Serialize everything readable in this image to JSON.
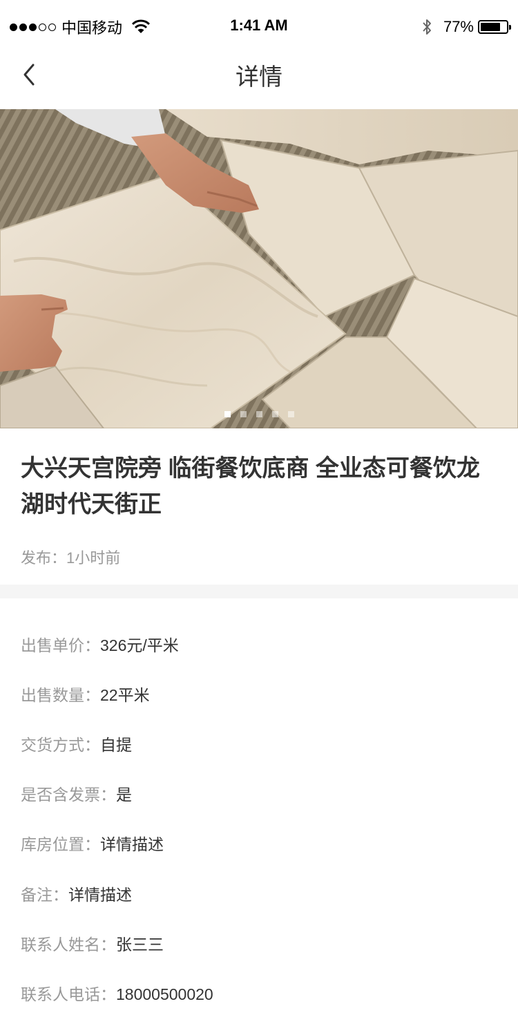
{
  "status_bar": {
    "carrier": "中国移动",
    "time": "1:41 AM",
    "battery_pct": "77%",
    "battery_level": 0.77
  },
  "nav": {
    "title": "详情",
    "back_icon": "chevron-left-icon"
  },
  "gallery": {
    "image_desc_icon": "tile-installation-photo",
    "page_count": 5,
    "active_index": 0
  },
  "listing": {
    "title": "大兴天宫院旁 临街餐饮底商 全业态可餐饮龙湖时代天街正",
    "publish_label": "发布：",
    "publish_value": "1小时前"
  },
  "details": [
    {
      "label": "出售单价：",
      "value": "326元/平米"
    },
    {
      "label": "出售数量：",
      "value": "22平米"
    },
    {
      "label": "交货方式：",
      "value": "自提"
    },
    {
      "label": "是否含发票：",
      "value": "是"
    },
    {
      "label": "库房位置：",
      "value": "详情描述"
    },
    {
      "label": "备注：",
      "value": "详情描述"
    },
    {
      "label": "联系人姓名：",
      "value": "张三三"
    },
    {
      "label": "联系人电话：",
      "value": "18000500020"
    }
  ]
}
